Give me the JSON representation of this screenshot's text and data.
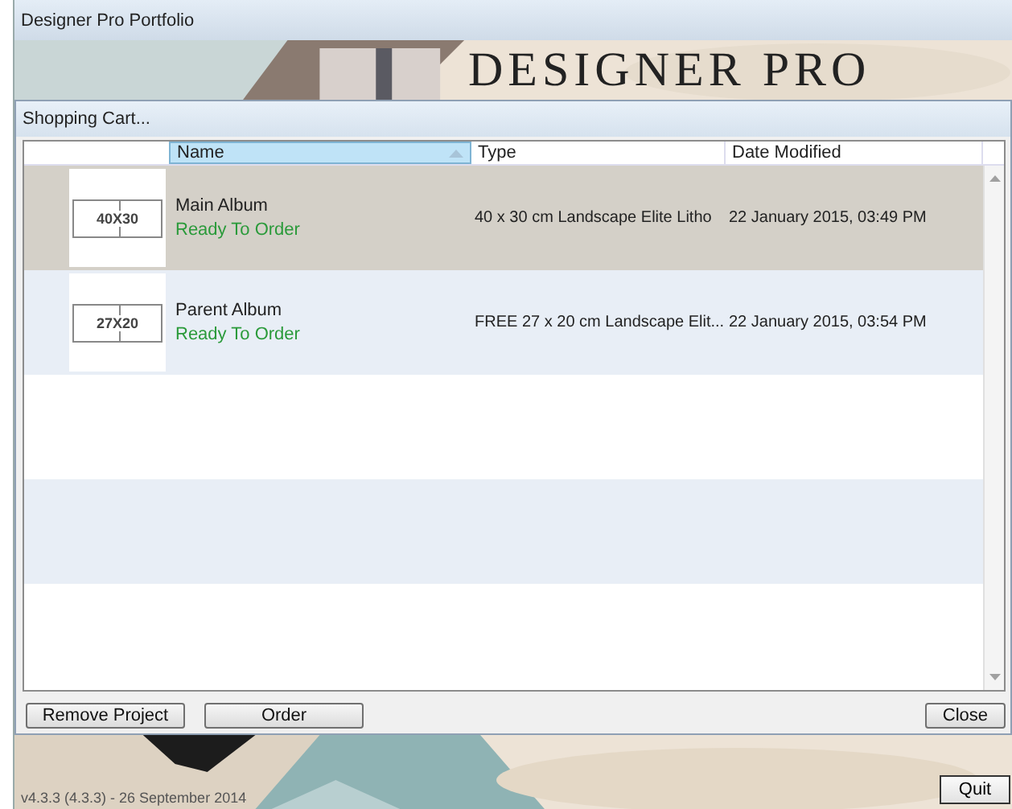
{
  "window": {
    "title": "Designer Pro Portfolio"
  },
  "banner": {
    "logo_text": "DESIGNER PRO"
  },
  "dialog": {
    "title": "Shopping Cart...",
    "columns": [
      {
        "label": "Name",
        "sorted": true
      },
      {
        "label": "Type",
        "sorted": false
      },
      {
        "label": "Date Modified",
        "sorted": false
      }
    ],
    "rows": [
      {
        "thumbnail_label": "40X30",
        "name": "Main Album",
        "status": "Ready To Order",
        "type": "40 x 30 cm Landscape Elite Litho",
        "date": "22 January 2015, 03:49 PM",
        "selected": true
      },
      {
        "thumbnail_label": "27X20",
        "name": "Parent Album",
        "status": "Ready To Order",
        "type": "FREE 27 x 20 cm Landscape Elit...",
        "date": "22 January 2015, 03:54 PM",
        "selected": false
      }
    ],
    "buttons_left": [
      "Remove Project",
      "Order"
    ],
    "buttons_right": [
      "Close"
    ]
  },
  "footer": {
    "version": "v4.3.3 (4.3.3) - 26 September 2014",
    "quit_button": "Quit"
  }
}
